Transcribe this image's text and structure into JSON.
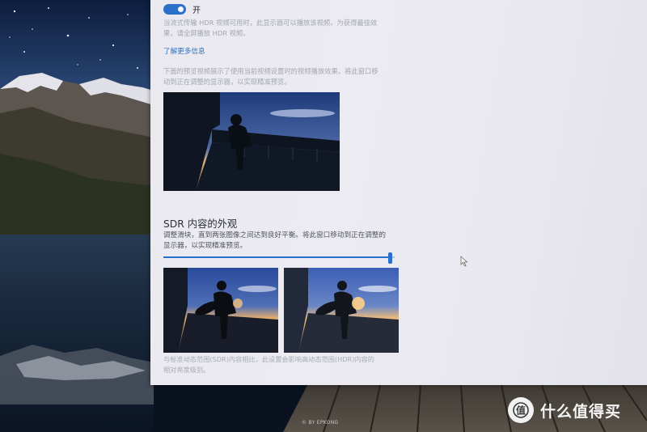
{
  "hdr": {
    "toggle_state": "on",
    "toggle_label": "开",
    "description_line1": "当流式传输 HDR 视频可用时，此显示器可以播放该视频。为获得最佳效",
    "description_line2": "果，请全屏播放 HDR 视频。",
    "learn_more": "了解更多信息",
    "preview_desc_line1": "下面的预览视频展示了使用当前视频设置时的视频播放效果。将此窗口移",
    "preview_desc_line2": "动到正在调整的显示器，以实现精准预览。"
  },
  "sdr": {
    "title": "SDR 内容的外观",
    "description_line1": "调整滑块，直到两张图像之间达到良好平衡。将此窗口移动到正在调整的",
    "description_line2": "显示器，以实现精准预览。",
    "slider_value_fraction": 0.98,
    "footnote_line1": "与标准动态范围(SDR)内容相比，此设置会影响高动态范围(HDR)内容的",
    "footnote_line2": "相对亮度级别。"
  },
  "photo_credit": "© BY EPKONG",
  "watermark_text": "什么值得买",
  "icons": [
    "toggle-switch",
    "slider-thumb",
    "mouse-cursor-icon",
    "smzdm-logo-icon"
  ],
  "colors": {
    "accent": "#2b70c8",
    "window_bg": "#eae9ef",
    "link": "#2d72c4"
  }
}
